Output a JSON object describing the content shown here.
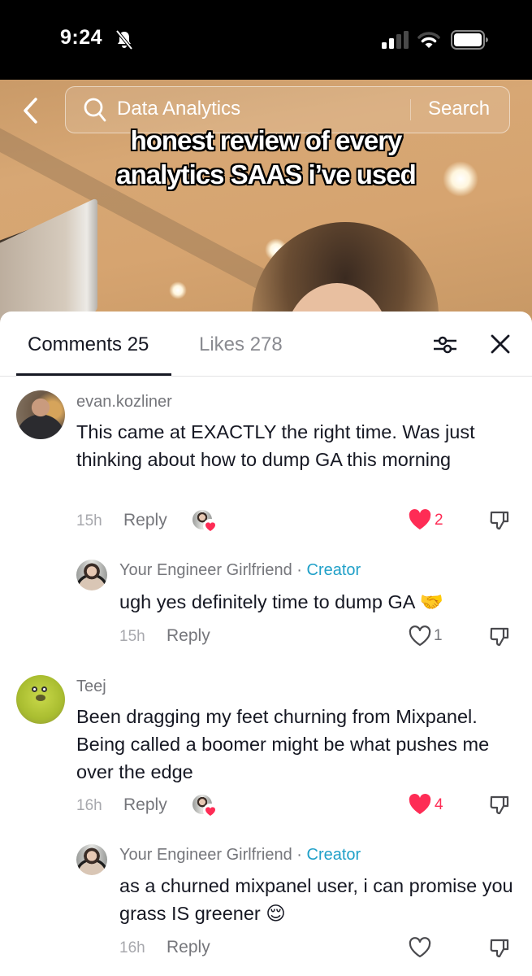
{
  "status_bar": {
    "time": "9:24",
    "icons": [
      "bell-slash-icon",
      "cellular-signal-icon",
      "wifi-icon",
      "battery-icon"
    ]
  },
  "video": {
    "search": {
      "query": "Data Analytics",
      "button_label": "Search"
    },
    "caption_line1": "honest review of every",
    "caption_line2": "analytics SAAS i’ve used"
  },
  "sheet": {
    "tabs": [
      {
        "label": "Comments 25",
        "active": true
      },
      {
        "label": "Likes 278",
        "active": false
      }
    ],
    "icons": [
      "filter-sliders-icon",
      "close-icon"
    ]
  },
  "comments": [
    {
      "username": "evan.kozliner",
      "text": "This came at EXACTLY the right time. Was just thinking about how to dump GA this morning",
      "time": "15h",
      "reply_label": "Reply",
      "liked_by_creator": true,
      "likes": "2",
      "liked": true,
      "replies": [
        {
          "username": "Your Engineer Girlfriend",
          "separator": "·",
          "badge": "Creator",
          "text": "ugh yes definitely time to dump GA 🤝",
          "time": "15h",
          "reply_label": "Reply",
          "likes": "1",
          "liked": false
        }
      ]
    },
    {
      "username": "Teej",
      "text": "Been dragging my feet churning from Mixpanel. Being called a boomer might be what pushes me over the edge",
      "time": "16h",
      "reply_label": "Reply",
      "liked_by_creator": true,
      "likes": "4",
      "liked": true,
      "replies": [
        {
          "username": "Your Engineer Girlfriend",
          "separator": "·",
          "badge": "Creator",
          "text": "as a churned mixpanel user, i can promise you grass IS greener 😌",
          "time": "16h",
          "reply_label": "Reply",
          "likes": "",
          "liked": false
        }
      ]
    }
  ],
  "colors": {
    "accent_like": "#fe2c55",
    "creator_badge": "#20a0c8",
    "text_primary": "#161823",
    "text_secondary": "#75767b"
  }
}
